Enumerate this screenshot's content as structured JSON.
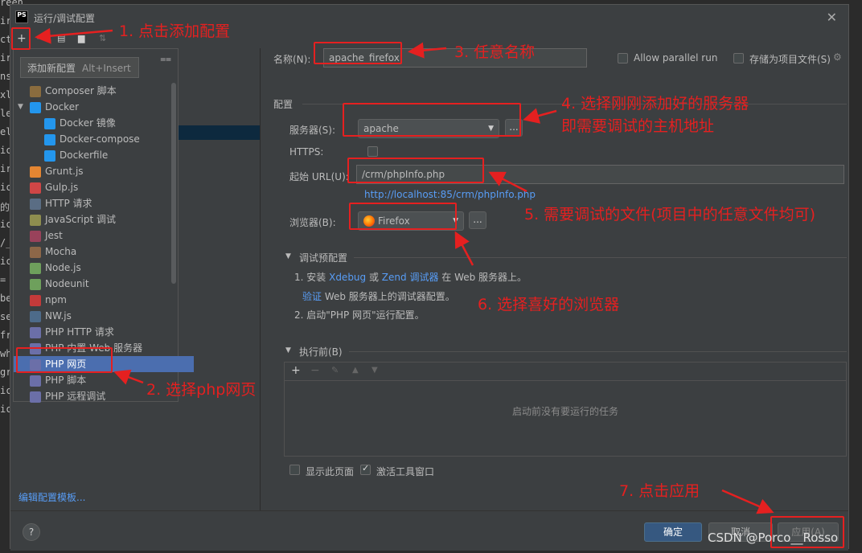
{
  "window": {
    "title": "运行/调试配置",
    "logo": "PS"
  },
  "background_code": [
    "reen",
    "ir",
    "ct",
    "ir",
    "ns",
    "xl",
    "le",
    "el",
    "ic",
    "ir",
    "ic",
    "的",
    "ic",
    "/_",
    "ic",
    "=",
    "be",
    "se",
    "fr",
    "wh",
    "gr",
    "ic",
    "ic"
  ],
  "toolbar": {
    "add": "+",
    "remove": "−"
  },
  "popup": {
    "tooltip": "添加新配置",
    "shortcut": "Alt+Insert",
    "items": [
      {
        "label": "Composer 脚本",
        "icon": "composer-icon",
        "color": "#8a6c3e"
      },
      {
        "label": "Docker",
        "icon": "docker-icon",
        "color": "#2396ed",
        "expanded": "true"
      },
      {
        "label": "Docker 镜像",
        "icon": "docker-icon",
        "color": "#2396ed"
      },
      {
        "label": "Docker-compose",
        "icon": "docker-icon",
        "color": "#2396ed"
      },
      {
        "label": "Dockerfile",
        "icon": "docker-icon",
        "color": "#2396ed"
      },
      {
        "label": "Grunt.js",
        "icon": "grunt-icon",
        "color": "#e48632"
      },
      {
        "label": "Gulp.js",
        "icon": "gulp-icon",
        "color": "#cf4646"
      },
      {
        "label": "HTTP 请求",
        "icon": "http-api-icon",
        "color": "#5a6d84"
      },
      {
        "label": "JavaScript 调试",
        "icon": "js-debug-icon",
        "color": "#8e8e4f"
      },
      {
        "label": "Jest",
        "icon": "jest-icon",
        "color": "#99425b"
      },
      {
        "label": "Mocha",
        "icon": "mocha-icon",
        "color": "#8d6748"
      },
      {
        "label": "Node.js",
        "icon": "nodejs-icon",
        "color": "#6ea05c"
      },
      {
        "label": "Nodeunit",
        "icon": "nodeunit-icon",
        "color": "#6ea05c"
      },
      {
        "label": "npm",
        "icon": "npm-icon",
        "color": "#c33a3a"
      },
      {
        "label": "NW.js",
        "icon": "nwjs-icon",
        "color": "#4d6b8a"
      },
      {
        "label": "PHP HTTP 请求",
        "icon": "php-icon",
        "color": "#6b6fa8"
      },
      {
        "label": "PHP 内置 Web 服务器",
        "icon": "php-icon",
        "color": "#6b6fa8"
      },
      {
        "label": "PHP 网页",
        "icon": "php-icon",
        "color": "#6b6fa8",
        "selected": "true"
      },
      {
        "label": "PHP 脚本",
        "icon": "php-icon",
        "color": "#6b6fa8"
      },
      {
        "label": "PHP 远程调试",
        "icon": "php-icon",
        "color": "#6b6fa8"
      }
    ]
  },
  "edit_templates_link": "编辑配置模板...",
  "form": {
    "name_label": "名称(N):",
    "name_value": "apache_firefox",
    "allow_parallel": "Allow parallel run",
    "store_as_project": "存储为项目文件(S)",
    "config_section": "配置",
    "server_label": "服务器(S):",
    "server_value": "apache",
    "https_label": "HTTPS:",
    "url_label": "起始 URL(U):",
    "url_value": "/crm/phpInfo.php",
    "url_preview": "http://localhost:85/crm/phpInfo.php",
    "browser_label": "浏览器(B):",
    "browser_value": "Firefox",
    "ellipsis": "...",
    "debug_section": "调试预配置",
    "debug_line1": {
      "prefix": "1. 安装 ",
      "xdebug": "Xdebug",
      "or": " 或 ",
      "zend": "Zend 调试器",
      "suffix": " 在 Web 服务器上。"
    },
    "debug_line2": {
      "verify": "验证",
      "rest": " Web 服务器上的调试器配置。"
    },
    "debug_line3": "2. 启动\"PHP 网页\"运行配置。",
    "before_launch": "执行前(B)",
    "no_tasks": "启动前没有要运行的任务",
    "show_page": "显示此页面",
    "activate_tool": "激活工具窗口"
  },
  "buttons": {
    "help": "?",
    "ok": "确定",
    "cancel": "取消",
    "apply": "应用(A)"
  },
  "annotations": {
    "a1": "1. 点击添加配置",
    "a2": "2. 选择php网页",
    "a3": "3. 任意名称",
    "a4_line1": "4. 选择刚刚添加好的服务器",
    "a4_line2": "即需要调试的主机地址",
    "a5": "5. 需要调试的文件(项目中的任意文件均可)",
    "a6": "6. 选择喜好的浏览器",
    "a7": "7. 点击应用"
  },
  "watermark": "CSDN @Porco__Rosso",
  "colors": {
    "annotation_red": "#e52020",
    "selection_blue": "#4b6eaf",
    "link_blue": "#589df6",
    "ok_button": "#365880"
  }
}
